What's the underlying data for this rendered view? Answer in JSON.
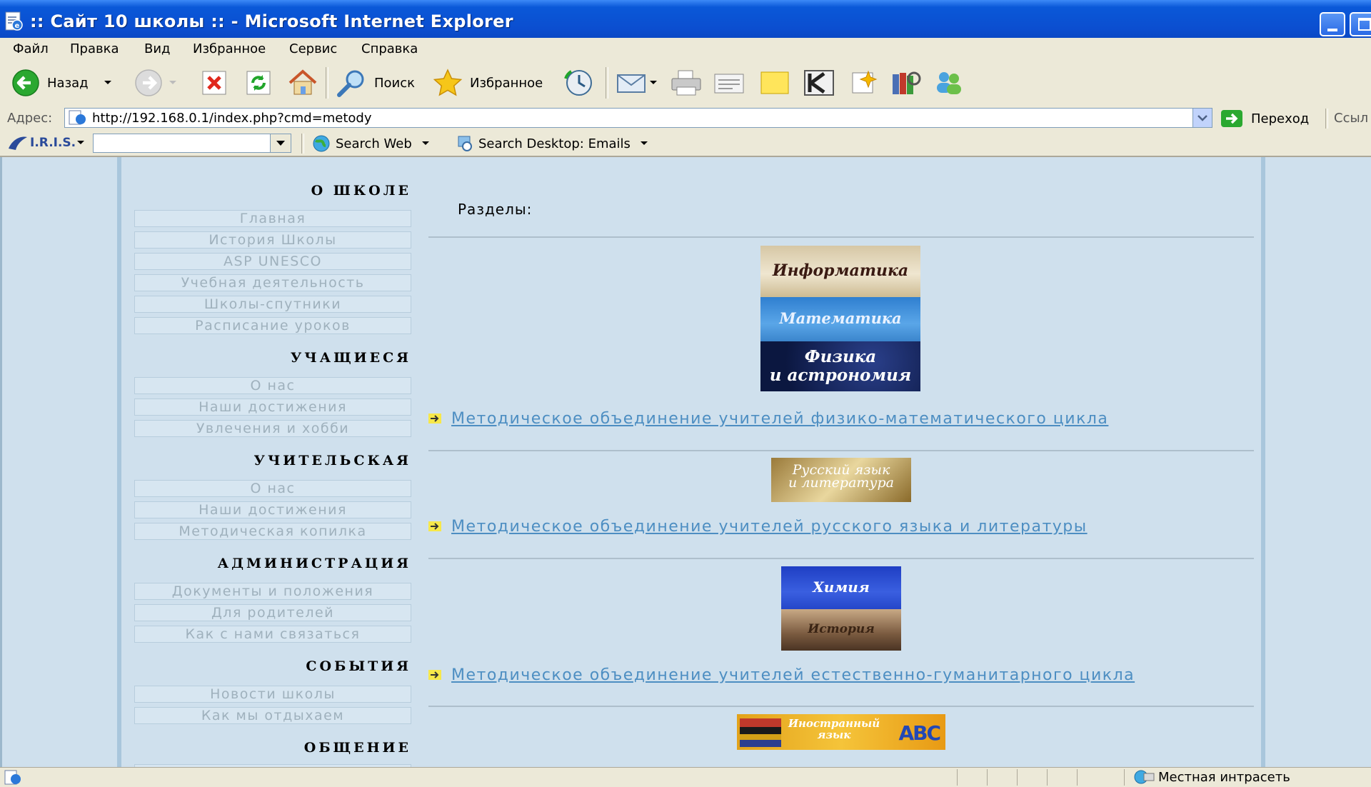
{
  "window": {
    "title": ":: Сайт 10 школы :: - Microsoft Internet Explorer",
    "accent": "#0b4ed0"
  },
  "menu": [
    "Файл",
    "Правка",
    "Вид",
    "Избранное",
    "Сервис",
    "Справка"
  ],
  "toolbar": {
    "back_label": "Назад",
    "search_label": "Поиск",
    "favorites_label": "Избранное"
  },
  "address": {
    "label": "Адрес:",
    "url": "http://192.168.0.1/index.php?cmd=metody",
    "go_label": "Переход",
    "links_label": "Ссыл"
  },
  "linksbar": {
    "iris_label": "I.R.I.S.",
    "search_web_label": "Search Web",
    "search_desktop_label": "Search Desktop: Emails"
  },
  "sidebar": {
    "sections": [
      {
        "title": "О ШКОЛЕ",
        "items": [
          "Главная",
          "История Школы",
          "ASP UNESCO",
          "Учебная деятельность",
          "Школы-спутники",
          "Расписание уроков"
        ]
      },
      {
        "title": "УЧАЩИЕСЯ",
        "items": [
          "О нас",
          "Наши достижения",
          "Увлечения и хобби"
        ]
      },
      {
        "title": "УЧИТЕЛЬСКАЯ",
        "items": [
          "О нас",
          "Наши достижения",
          "Методическая копилка"
        ]
      },
      {
        "title": "АДМИНИСТРАЦИЯ",
        "items": [
          "Документы и положения",
          "Для родителей",
          "Как с нами связаться"
        ]
      },
      {
        "title": "СОБЫТИЯ",
        "items": [
          "Новости школы",
          "Как мы отдыхаем"
        ]
      },
      {
        "title": "ОБЩЕНИЕ",
        "items": []
      }
    ]
  },
  "main": {
    "heading": "Разделы:",
    "banners": {
      "informatika": "Информатика",
      "matematika": "Математика",
      "fizika_1": "Физика",
      "fizika_2": "и астрономия",
      "russkiy_1": "Русский язык",
      "russkiy_2": "и литература",
      "himiya": "Химия",
      "istoriya": "История",
      "inostr_1": "Иностранный",
      "inostr_2": "язык",
      "abc": "ABC"
    },
    "links": [
      "Методическое объединение учителей физико-математического цикла",
      "Методическое объединение учителей русского языка и литературы",
      "Методическое объединение учителей естественно-гуманитарного цикла"
    ]
  },
  "status": {
    "zone": "Местная интрасеть"
  }
}
